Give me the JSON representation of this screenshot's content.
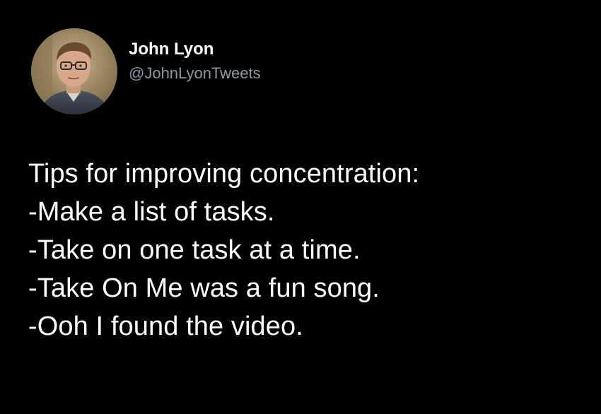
{
  "author": {
    "name": "John Lyon",
    "handle": "@JohnLyonTweets",
    "avatar_icon": "profile-photo-avatar"
  },
  "tweet": {
    "lines": [
      "Tips for improving concentration:",
      "-Make a list of tasks.",
      "-Take on one task at a time.",
      "-Take On Me was a fun song.",
      "-Ooh I found the video."
    ]
  },
  "colors": {
    "background": "#000000",
    "text": "#ffffff",
    "handle": "#8b98a5"
  }
}
